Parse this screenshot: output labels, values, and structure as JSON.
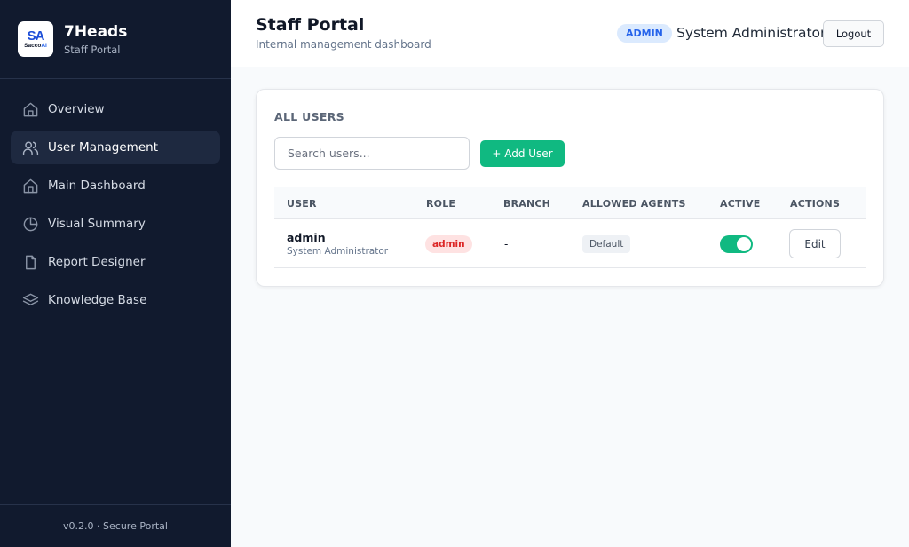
{
  "brand": {
    "name": "7Heads",
    "subtitle": "Staff Portal",
    "logo_mark": "SA",
    "logo_text_a": "Sacco",
    "logo_text_b": "AI"
  },
  "sidebar": {
    "items": [
      {
        "label": "Overview",
        "icon": "home-icon",
        "active": false
      },
      {
        "label": "User Management",
        "icon": "users-icon",
        "active": true
      },
      {
        "label": "Main Dashboard",
        "icon": "home-icon",
        "active": false
      },
      {
        "label": "Visual Summary",
        "icon": "pie-chart-icon",
        "active": false
      },
      {
        "label": "Report Designer",
        "icon": "file-icon",
        "active": false
      },
      {
        "label": "Knowledge Base",
        "icon": "layers-icon",
        "active": false
      }
    ],
    "footer": "v0.2.0 · Secure Portal"
  },
  "header": {
    "title": "Staff Portal",
    "subtitle": "Internal management dashboard",
    "role_badge": "ADMIN",
    "user_name": "System Administrator",
    "logout_label": "Logout"
  },
  "users_card": {
    "title": "ALL USERS",
    "search_placeholder": "Search users...",
    "add_button_label": "+ Add User",
    "columns": [
      "USER",
      "ROLE",
      "BRANCH",
      "ALLOWED AGENTS",
      "ACTIVE",
      "ACTIONS"
    ],
    "rows": [
      {
        "username": "admin",
        "full_name": "System Administrator",
        "role": "admin",
        "branch": "-",
        "allowed_agents": "Default",
        "active": true,
        "action_label": "Edit"
      }
    ]
  },
  "colors": {
    "sidebar_bg": "#111a2e",
    "accent_green": "#10b981",
    "admin_badge_blue": "#2563eb",
    "role_pill_red": "#dc2626"
  }
}
